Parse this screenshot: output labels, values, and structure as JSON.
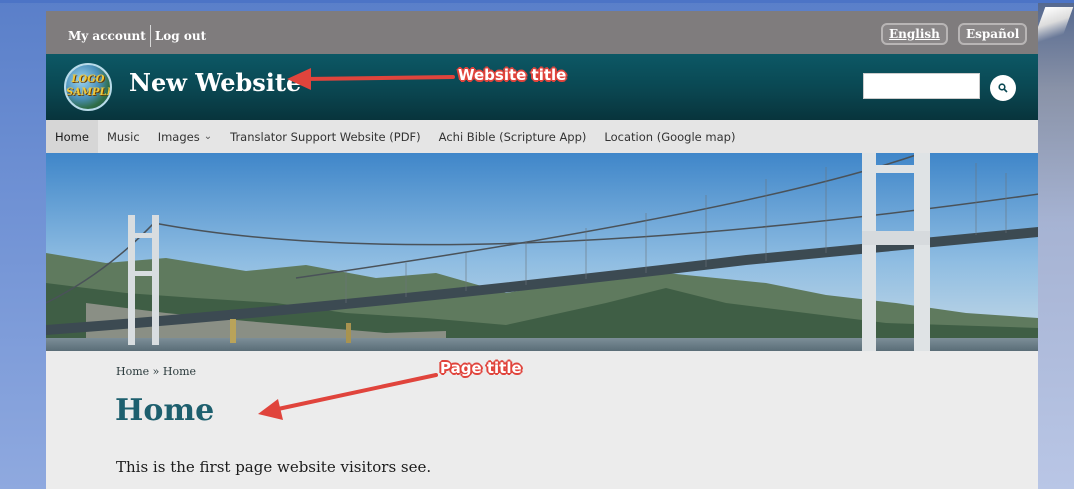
{
  "account": {
    "my_account": "My account",
    "log_out": "Log out"
  },
  "languages": {
    "english": "English",
    "spanish": "Español"
  },
  "header": {
    "logo_line1": "LOGO",
    "logo_line2": "SAMPLE",
    "site_title": "New Website"
  },
  "nav": {
    "items": [
      {
        "label": "Home"
      },
      {
        "label": "Music"
      },
      {
        "label": "Images"
      },
      {
        "label": "Translator Support Website (PDF)"
      },
      {
        "label": "Achi Bible (Scripture App)"
      },
      {
        "label": "Location (Google map)"
      }
    ]
  },
  "content": {
    "breadcrumb": "Home » Home",
    "page_title": "Home",
    "body": "This is the first page website visitors see."
  },
  "annotations": {
    "website_title": "Website title",
    "page_title": "Page title"
  },
  "colors": {
    "header": "#0a4853",
    "topbar": "#7f7c7d",
    "title_teal": "#1d5f6e",
    "callout_red": "#e0443c"
  }
}
